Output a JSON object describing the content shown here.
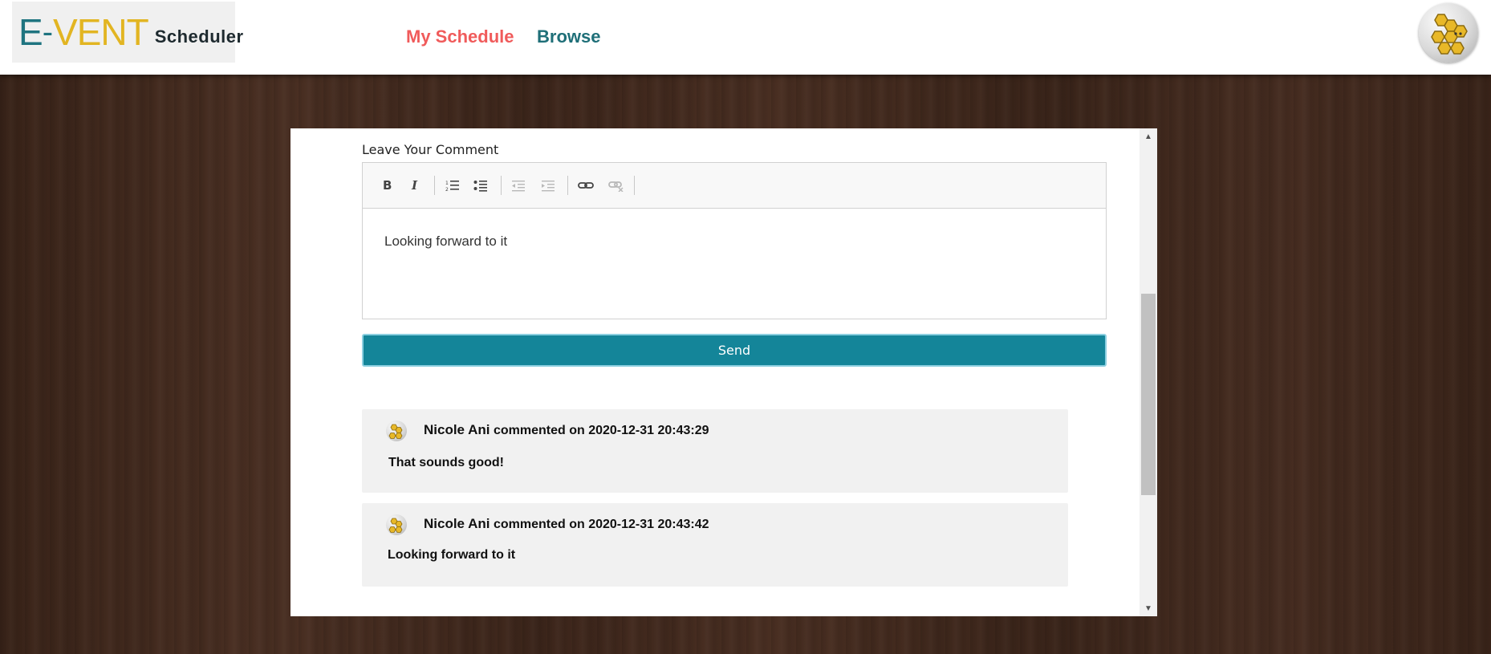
{
  "header": {
    "logo": {
      "part1": "E",
      "dash": "-",
      "part2": "VENT",
      "part3": "Scheduler"
    },
    "nav": [
      {
        "label": "My Schedule",
        "color": "#f05b5b"
      },
      {
        "label": "Browse",
        "color": "#1f6f78"
      }
    ],
    "avatar_icon": "honeycomb-bee-icon"
  },
  "comment_form": {
    "label": "Leave Your Comment",
    "toolbar": [
      "bold-icon",
      "italic-icon",
      "numbered-list-icon",
      "bulleted-list-icon",
      "decrease-indent-icon",
      "increase-indent-icon",
      "link-icon",
      "unlink-icon"
    ],
    "editor_text": "Looking forward to it",
    "send_label": "Send",
    "accent": "#148599"
  },
  "comments": [
    {
      "author": "Nicole Ani",
      "meta": "commented on 2020-12-31 20:43:29",
      "text": "That sounds good!"
    },
    {
      "author": "Nicole Ani",
      "meta": "commented on 2020-12-31 20:43:42",
      "text": "Looking forward to it"
    }
  ]
}
